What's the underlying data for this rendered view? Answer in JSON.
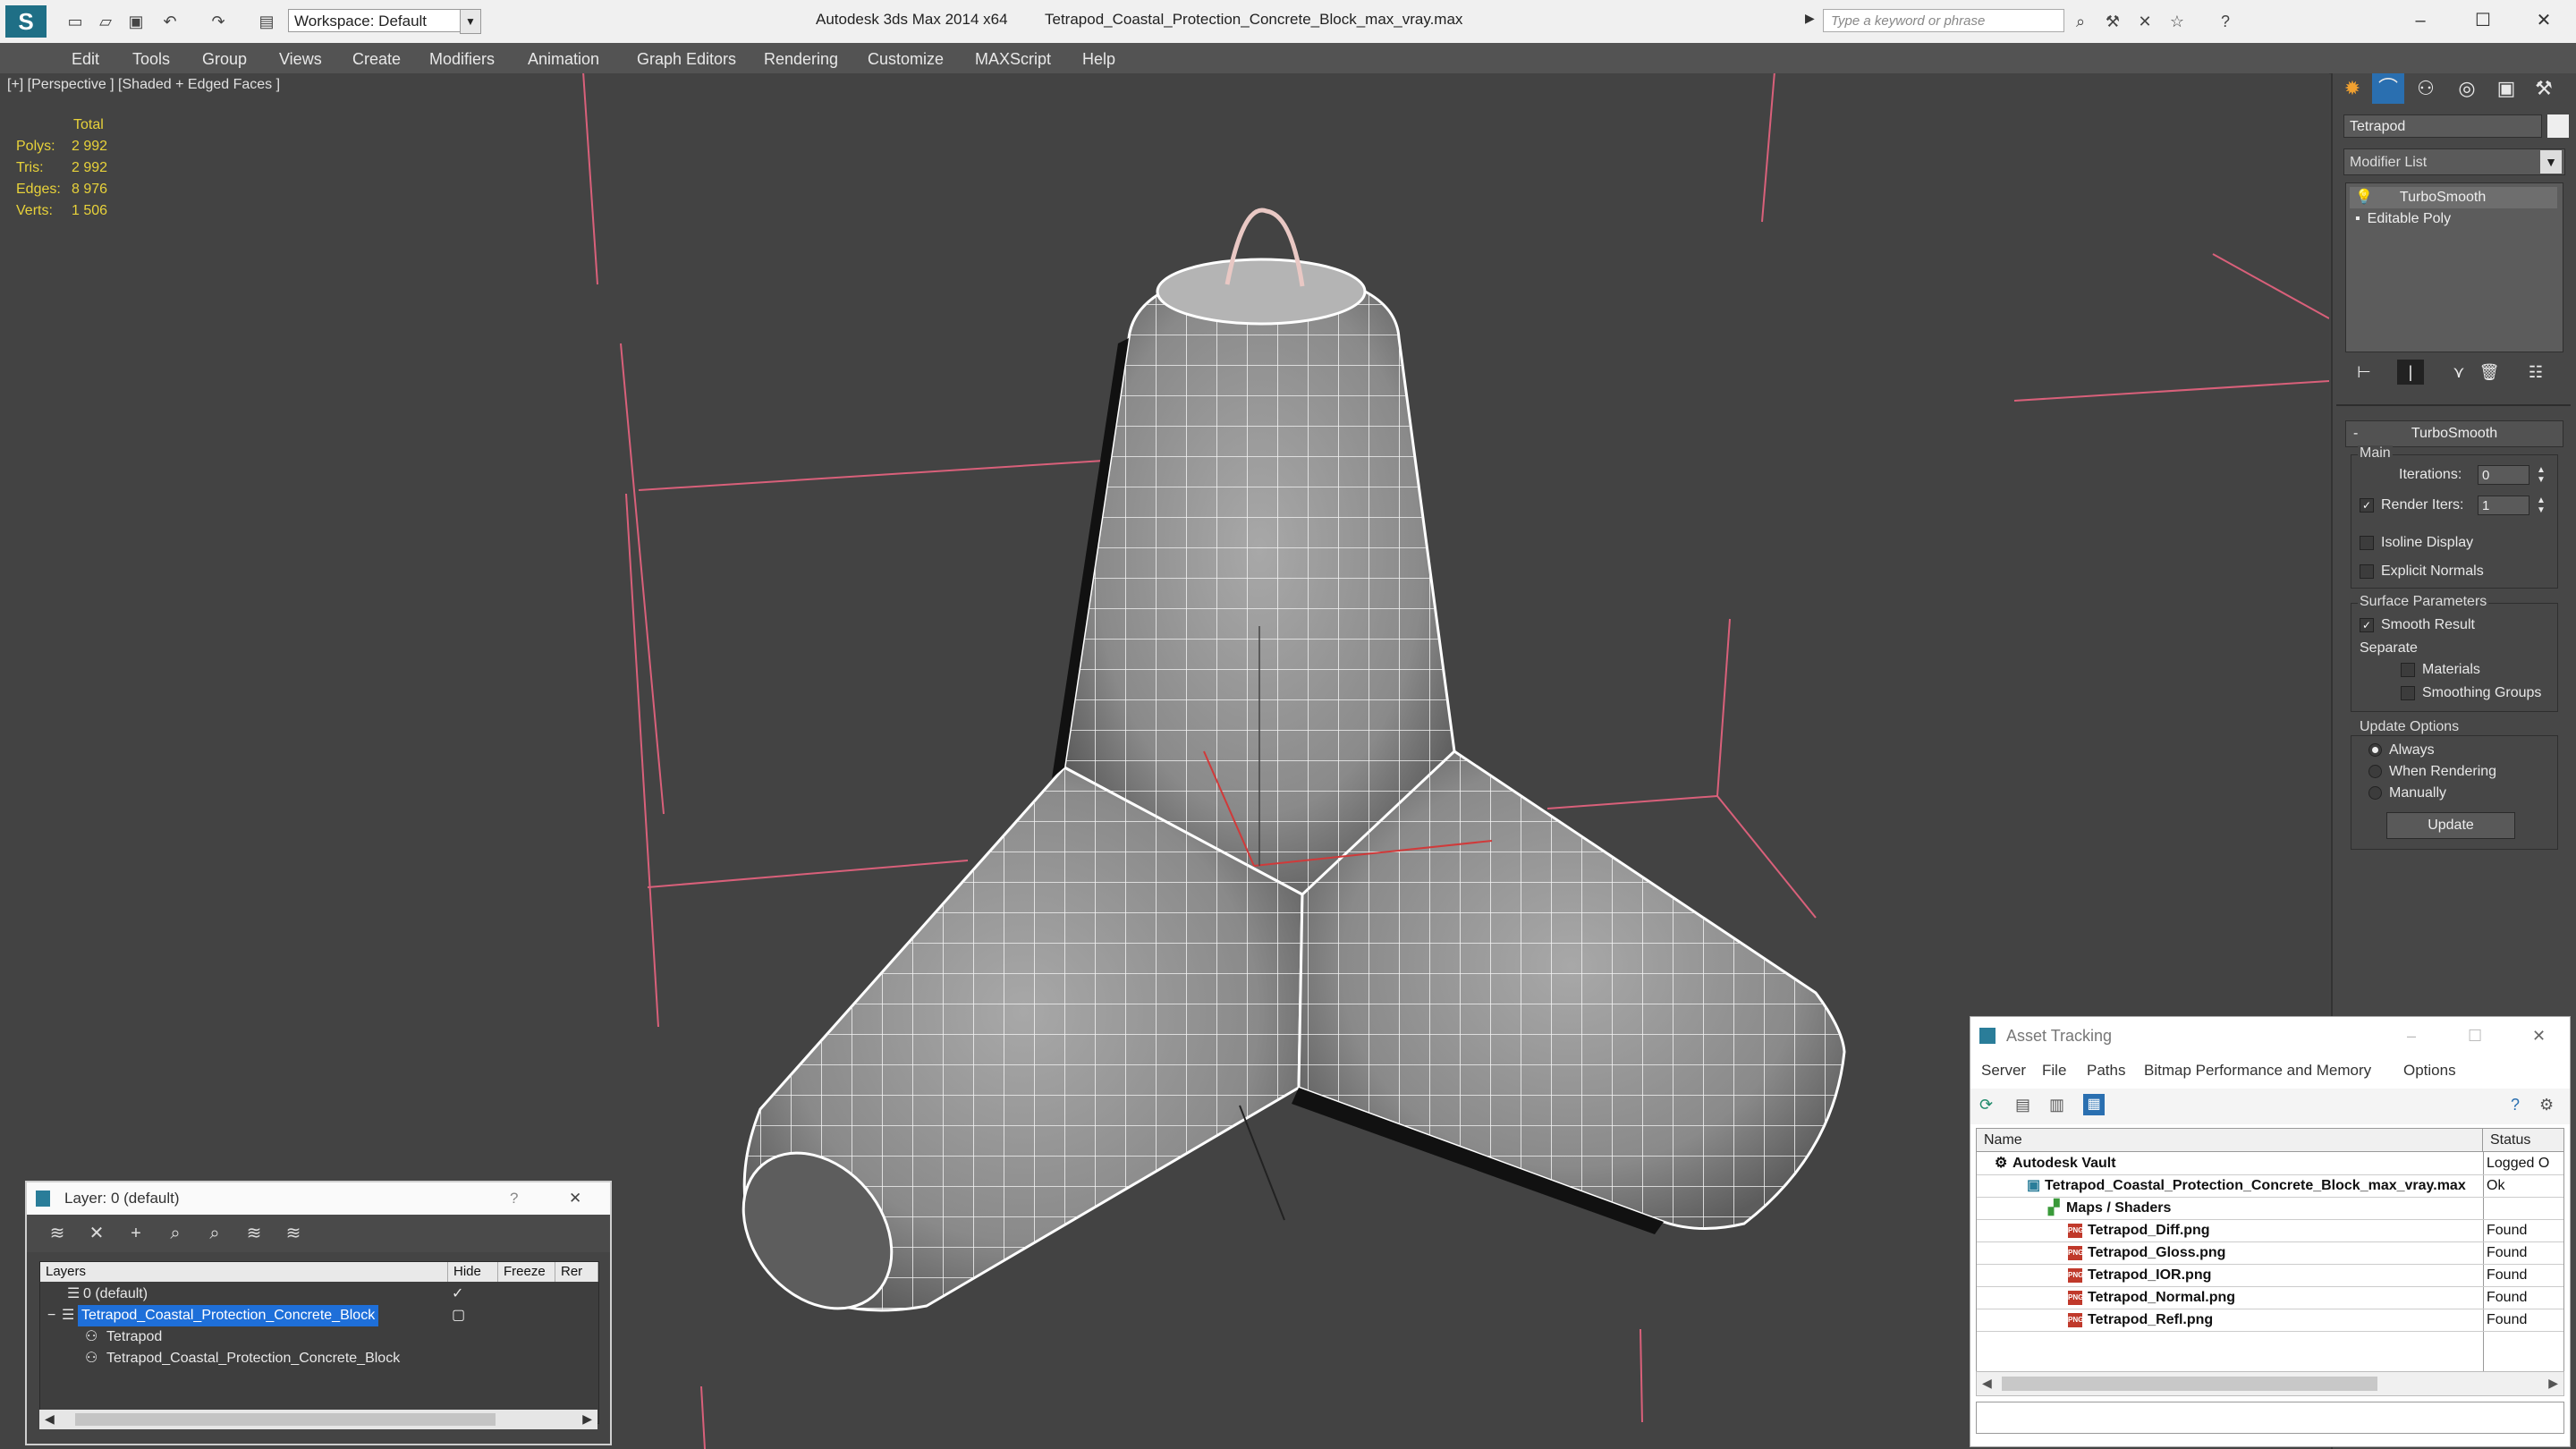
{
  "titlebar": {
    "app": "Autodesk 3ds Max  2014 x64",
    "file": "Tetrapod_Coastal_Protection_Concrete_Block_max_vray.max",
    "workspace": "Workspace: Default",
    "search_placeholder": "Type a keyword or phrase"
  },
  "menu": [
    "Edit",
    "Tools",
    "Group",
    "Views",
    "Create",
    "Modifiers",
    "Animation",
    "Graph Editors",
    "Rendering",
    "Customize",
    "MAXScript",
    "Help"
  ],
  "viewport": {
    "label": "[+] [Perspective ] [Shaded + Edged Faces ]",
    "stats_header": "Total",
    "stats": [
      {
        "label": "Polys:",
        "value": "2 992"
      },
      {
        "label": "Tris:",
        "value": "2 992"
      },
      {
        "label": "Edges:",
        "value": "8 976"
      },
      {
        "label": "Verts:",
        "value": "1 506"
      }
    ]
  },
  "command_panel": {
    "object_name": "Tetrapod",
    "modifier_list": "Modifier List",
    "stack": [
      "TurboSmooth",
      "Editable Poly"
    ],
    "rollout": "TurboSmooth",
    "main_group": "Main",
    "iterations_label": "Iterations:",
    "iterations_value": "0",
    "render_iters_label": "Render Iters:",
    "render_iters_value": "1",
    "isoline": "Isoline Display",
    "explicit_normals": "Explicit Normals",
    "surface_group": "Surface Parameters",
    "smooth_result": "Smooth Result",
    "separate": "Separate",
    "materials": "Materials",
    "smoothing_groups": "Smoothing Groups",
    "update_group": "Update Options",
    "always": "Always",
    "when_rendering": "When Rendering",
    "manually": "Manually",
    "update_button": "Update"
  },
  "layer_window": {
    "title": "Layer: 0 (default)",
    "help": "?",
    "columns": [
      "Layers",
      "Hide",
      "Freeze",
      "Rer"
    ],
    "rows": [
      {
        "name": "0 (default)"
      },
      {
        "name": "Tetrapod_Coastal_Protection_Concrete_Block"
      },
      {
        "name": "Tetrapod"
      },
      {
        "name": "Tetrapod_Coastal_Protection_Concrete_Block"
      }
    ]
  },
  "asset_window": {
    "title": "Asset Tracking",
    "menu": [
      "Server",
      "File",
      "Paths",
      "Bitmap Performance and Memory",
      "Options"
    ],
    "columns": [
      "Name",
      "Status"
    ],
    "rows": [
      {
        "name": "Autodesk Vault",
        "status": "Logged O"
      },
      {
        "name": "Tetrapod_Coastal_Protection_Concrete_Block_max_vray.max",
        "status": "Ok"
      },
      {
        "name": "Maps / Shaders",
        "status": ""
      },
      {
        "name": "Tetrapod_Diff.png",
        "status": "Found"
      },
      {
        "name": "Tetrapod_Gloss.png",
        "status": "Found"
      },
      {
        "name": "Tetrapod_IOR.png",
        "status": "Found"
      },
      {
        "name": "Tetrapod_Normal.png",
        "status": "Found"
      },
      {
        "name": "Tetrapod_Refl.png",
        "status": "Found"
      }
    ],
    "png_badge": "PNG"
  },
  "colors": {
    "viewport_bg": "#434343",
    "stats_yellow": "#e8d23a",
    "grid_pink": "#e0607a",
    "selection_blue": "#1e6fd9"
  }
}
